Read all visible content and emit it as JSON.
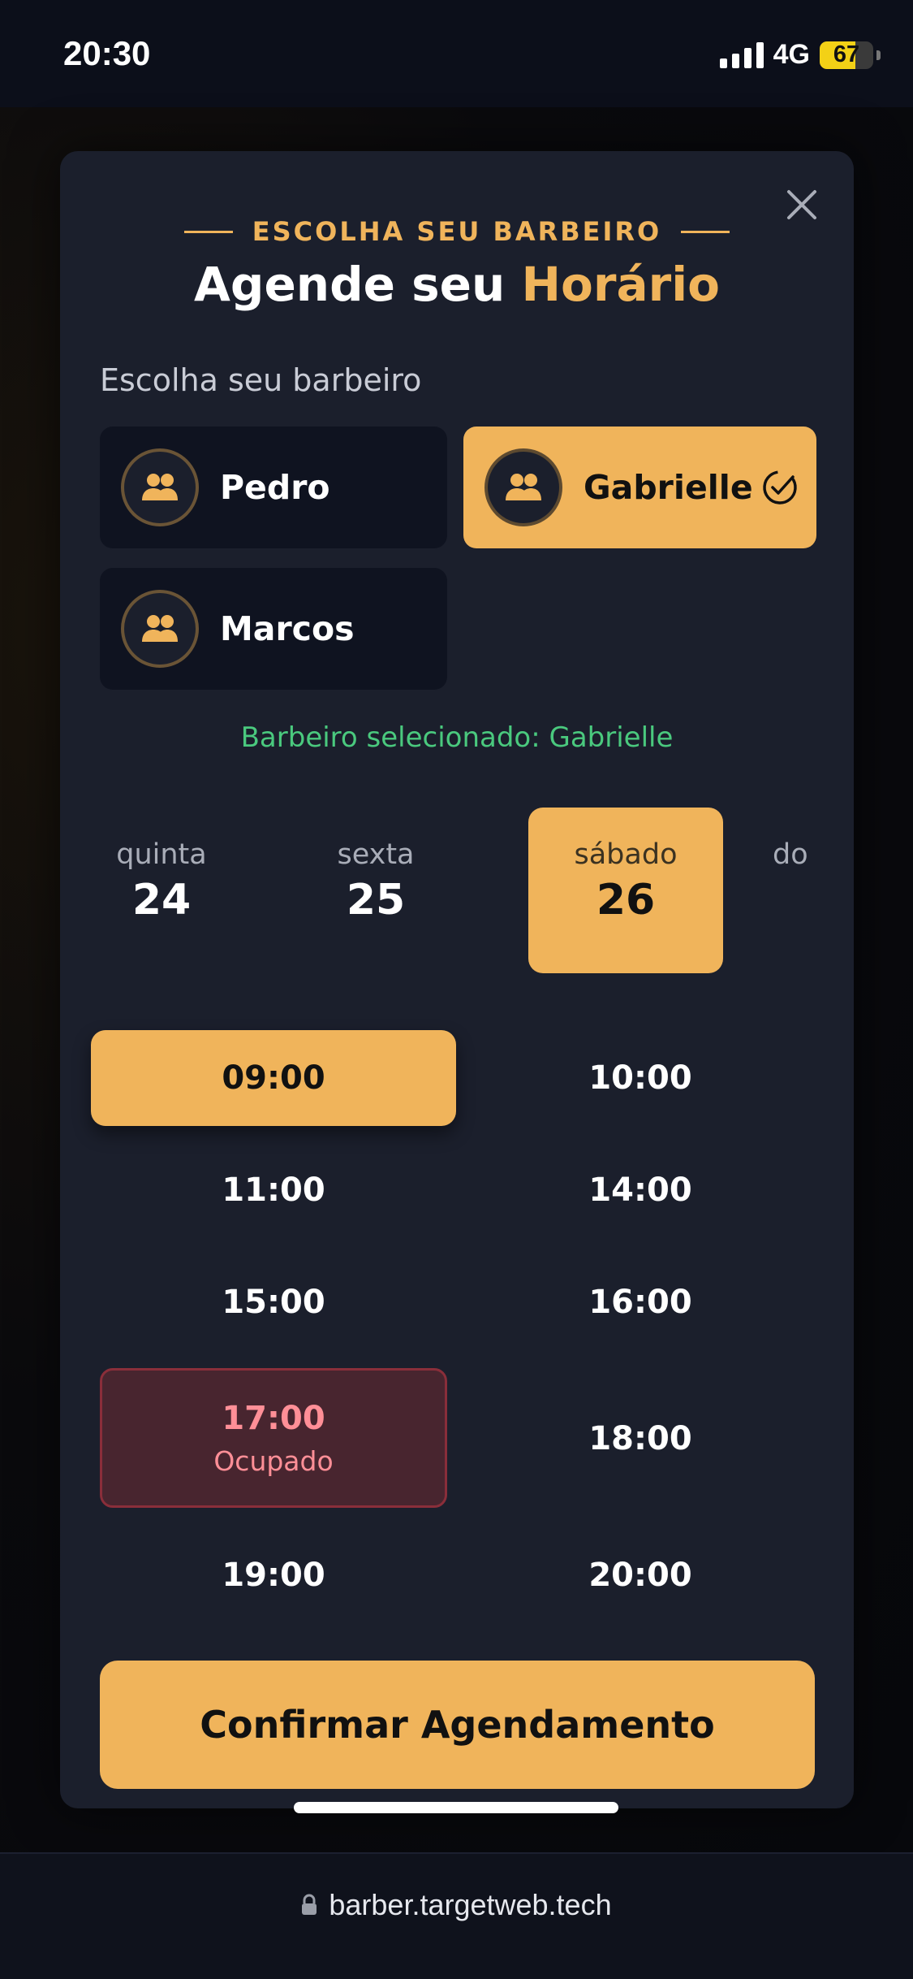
{
  "status": {
    "time": "20:30",
    "network": "4G",
    "battery": "67",
    "battery_level": 0.67
  },
  "modal": {
    "eyebrow": "ESCOLHA SEU BARBEIRO",
    "title_main": "Agende seu ",
    "title_accent": "Horário",
    "barber_section_label": "Escolha seu barbeiro",
    "barbers": [
      {
        "name": "Pedro",
        "icon": "users-icon",
        "selected": false
      },
      {
        "name": "Gabrielle",
        "icon": "users-icon",
        "selected": true
      },
      {
        "name": "Marcos",
        "icon": "users-icon",
        "selected": false
      }
    ],
    "selected_note": "Barbeiro selecionado: Gabrielle",
    "days": [
      {
        "name": "quinta",
        "num": "24"
      },
      {
        "name": "sexta",
        "num": "25"
      },
      {
        "name": "sábado",
        "num": "26",
        "selected": true
      },
      {
        "name": "do",
        "num": ""
      }
    ],
    "slots": [
      {
        "time": "09:00",
        "state": "selected"
      },
      {
        "time": "10:00",
        "state": "available"
      },
      {
        "time": "11:00",
        "state": "available"
      },
      {
        "time": "14:00",
        "state": "available"
      },
      {
        "time": "15:00",
        "state": "available"
      },
      {
        "time": "16:00",
        "state": "available"
      },
      {
        "time": "17:00",
        "state": "busy",
        "status": "Ocupado"
      },
      {
        "time": "18:00",
        "state": "available"
      },
      {
        "time": "19:00",
        "state": "available"
      },
      {
        "time": "20:00",
        "state": "available"
      }
    ],
    "confirm_label": "Confirmar Agendamento"
  },
  "browser": {
    "url": "barber.targetweb.tech"
  },
  "colors": {
    "accent": "#f0b45b",
    "success": "#4ac97e",
    "danger": "#ff8f97",
    "modal_bg": "#1b1f2c"
  }
}
